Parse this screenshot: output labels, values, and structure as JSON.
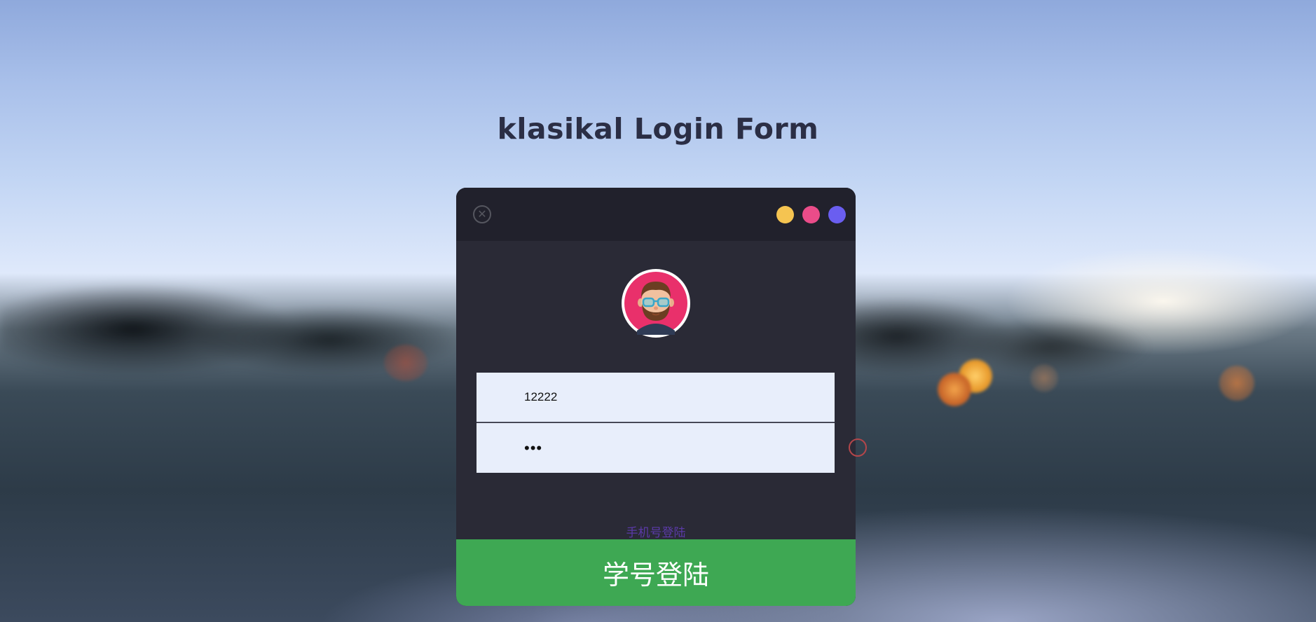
{
  "page": {
    "title": "klasikal Login Form"
  },
  "card": {
    "close_icon": "close-icon",
    "window_dots": [
      {
        "name": "yellow",
        "color": "#f5c451"
      },
      {
        "name": "pink",
        "color": "#ea4c89"
      },
      {
        "name": "purple",
        "color": "#6a5ef0"
      }
    ],
    "avatar_icon": "avatar-icon"
  },
  "form": {
    "username_value": "12222",
    "password_value": "•••",
    "alt_login_link": "手机号登陆",
    "submit_label": "学号登陆"
  },
  "colors": {
    "card_bg": "#2a2a36",
    "submit_bg": "#3ea853",
    "link": "#5b3aa8"
  }
}
